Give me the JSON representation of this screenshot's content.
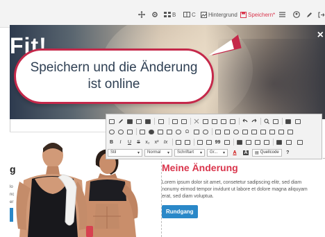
{
  "topbar": {
    "view_b": "B",
    "view_c": "C",
    "background_label": "Hintergrund",
    "save_label": "Speichern*"
  },
  "hero": {
    "title": "Fit!",
    "close": "×"
  },
  "callout": {
    "line1": "Speichern und die Änderung",
    "line2": "ist online"
  },
  "editor": {
    "style_combo": "Stil",
    "format_combo": "Normal",
    "font_combo": "Schriftart",
    "size_combo": "Gr...",
    "source_label": "Quellcode",
    "help_label": "?"
  },
  "left_fragment": {
    "heading": "g",
    "text": "lo nc er"
  },
  "content": {
    "title": "Meine Änderung",
    "text": "Lorem ipsum dolor sit amet, consetetur sadipscing elitr, sed diam nonumy eirmod tempor invidunt ut labore et dolore magna aliquyam erat, sed diam voluptua.",
    "button": "Rundgang"
  },
  "colors": {
    "accent": "#d9344b",
    "callout_border": "#c5284a",
    "button_blue": "#2a88c8",
    "callout_text": "#2e3f53"
  }
}
